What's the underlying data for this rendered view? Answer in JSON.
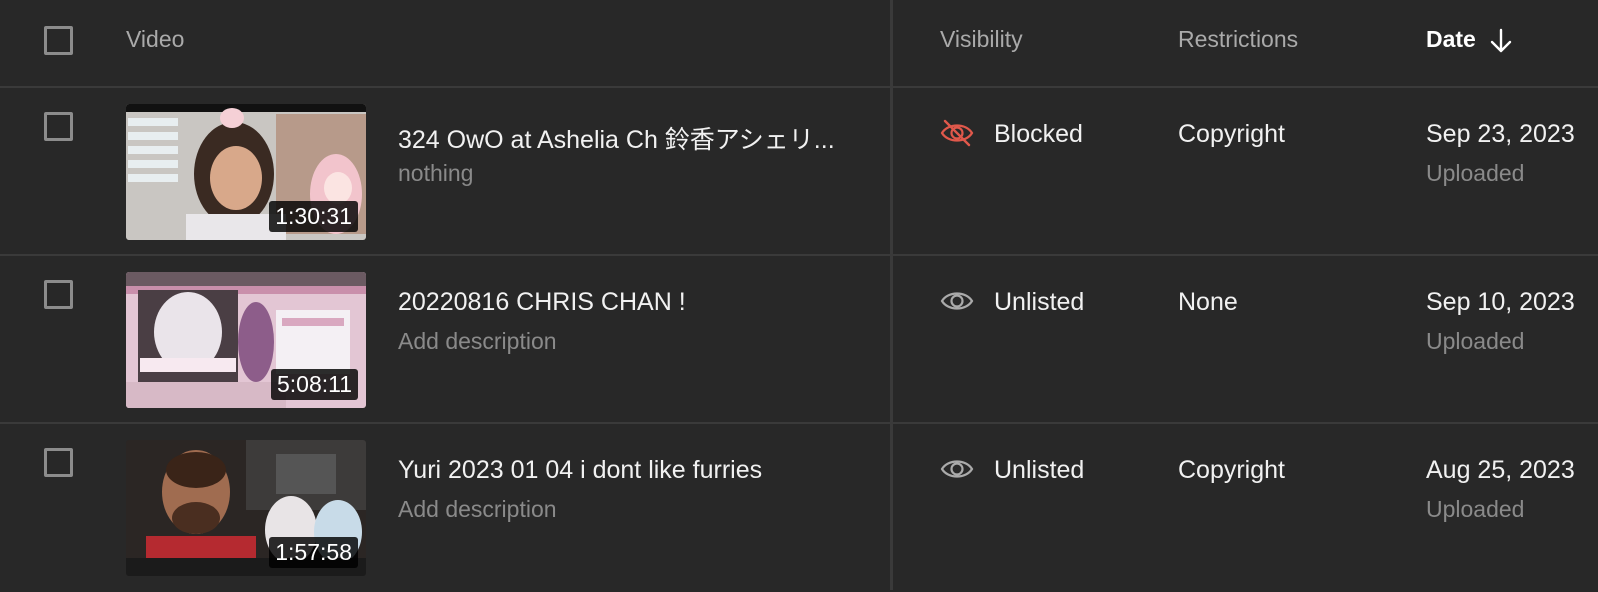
{
  "header": {
    "video_label": "Video",
    "visibility_label": "Visibility",
    "restrictions_label": "Restrictions",
    "date_label": "Date"
  },
  "rows": [
    {
      "title": "324 OwO at Ashelia Ch 鈴香アシェリ...",
      "description": "nothing",
      "duration": "1:30:31",
      "visibility": "Blocked",
      "visibility_icon": "eye-off-icon",
      "restrictions": "Copyright",
      "date": "Sep 23, 2023",
      "date_status": "Uploaded"
    },
    {
      "title": "20220816 CHRIS CHAN !",
      "description": "Add description",
      "duration": "5:08:11",
      "visibility": "Unlisted",
      "visibility_icon": "eye-icon",
      "restrictions": "None",
      "date": "Sep 10, 2023",
      "date_status": "Uploaded"
    },
    {
      "title": "Yuri 2023 01 04 i dont like furries",
      "description": "Add description",
      "duration": "1:57:58",
      "visibility": "Unlisted",
      "visibility_icon": "eye-icon",
      "restrictions": "Copyright",
      "date": "Aug 25, 2023",
      "date_status": "Uploaded"
    }
  ],
  "colors": {
    "background": "#282828",
    "blocked_icon": "#e0584b",
    "muted_text": "#8a8a8a"
  }
}
